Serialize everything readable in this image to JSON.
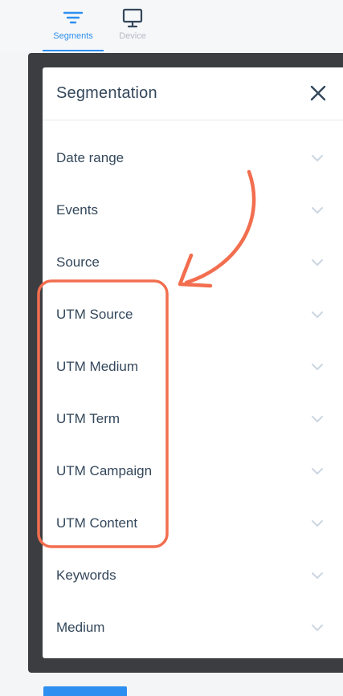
{
  "tabs": [
    {
      "label": "Segments",
      "icon": "filter-icon",
      "active": true
    },
    {
      "label": "Device",
      "icon": "monitor-icon",
      "active": false
    }
  ],
  "panel": {
    "title": "Segmentation",
    "close_icon": "close-icon",
    "items": [
      {
        "label": "Date range"
      },
      {
        "label": "Events"
      },
      {
        "label": "Source"
      },
      {
        "label": "UTM Source"
      },
      {
        "label": "UTM Medium"
      },
      {
        "label": "UTM Term"
      },
      {
        "label": "UTM Campaign"
      },
      {
        "label": "UTM Content"
      },
      {
        "label": "Keywords"
      },
      {
        "label": "Medium"
      }
    ]
  },
  "colors": {
    "accent": "#2d8ff0",
    "text": "#33475b",
    "annotation": "#f26e4f",
    "backdrop": "#3b3d40"
  }
}
